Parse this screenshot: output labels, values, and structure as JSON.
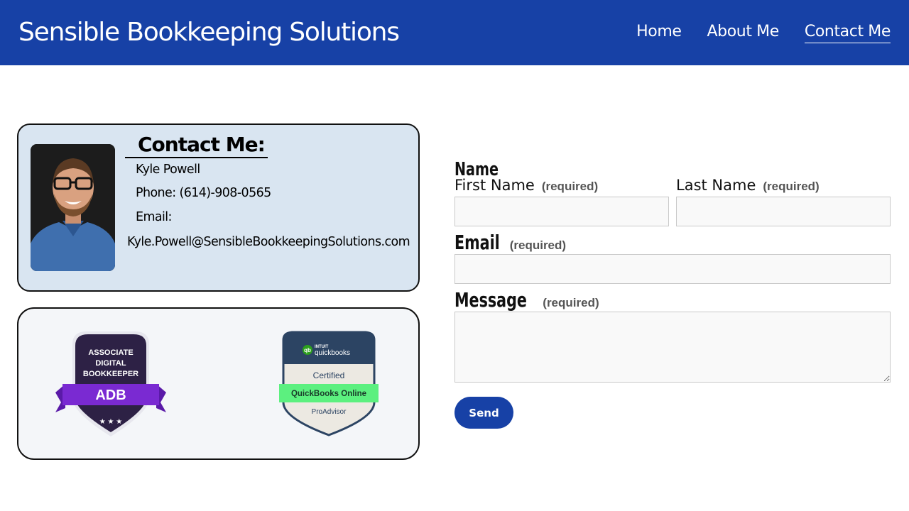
{
  "header": {
    "site_title": "Sensible Bookkeeping Solutions",
    "nav": [
      {
        "label": "Home",
        "active": false
      },
      {
        "label": "About Me",
        "active": false
      },
      {
        "label": "Contact Me",
        "active": true
      }
    ],
    "bg_color": "#1741a6"
  },
  "contact_card": {
    "heading": "Contact Me:",
    "name": "Kyle Powell",
    "phone": "Phone: (614)-908-0565",
    "email_label": "Email:",
    "email": "Kyle.Powell@SensibleBookkeepingSolutions.com",
    "bg_color": "#d9e5f1"
  },
  "badges": {
    "adb": {
      "line1": "ASSOCIATE",
      "line2": "DIGITAL",
      "line3": "BOOKKEEPER",
      "ribbon": "ADB"
    },
    "quickbooks": {
      "brand_top": "INTUIT",
      "brand": "quickbooks",
      "certified": "Certified",
      "product": "QuickBooks Online",
      "footer": "ProAdvisor"
    }
  },
  "form": {
    "name_group": "Name",
    "first_name_label": "First Name",
    "last_name_label": "Last Name",
    "email_label": "Email",
    "message_label": "Message",
    "required": "(required)",
    "first_name_value": "",
    "last_name_value": "",
    "email_value": "",
    "message_value": "",
    "send_label": "Send"
  }
}
